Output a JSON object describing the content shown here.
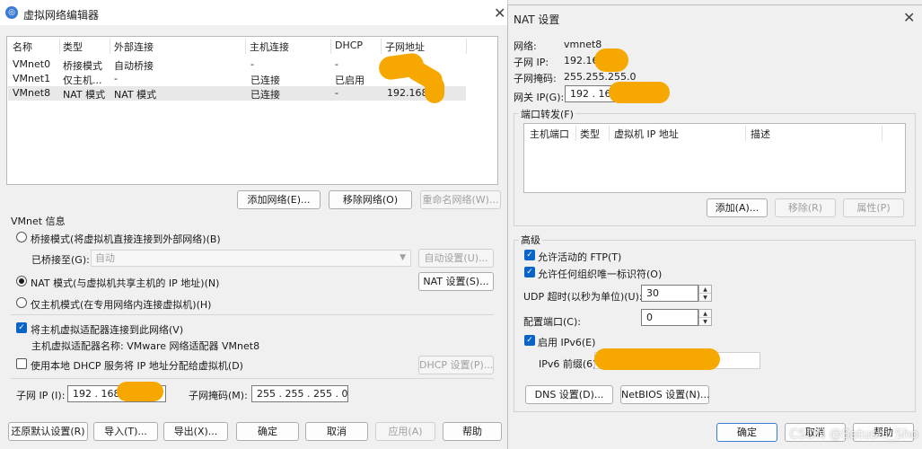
{
  "left": {
    "title": "虚拟网络编辑器",
    "table": {
      "headers": [
        "名称",
        "类型",
        "外部连接",
        "主机连接",
        "DHCP",
        "子网地址"
      ],
      "rows": [
        [
          "VMnet0",
          "桥接模式",
          "自动桥接",
          "-",
          "-",
          ""
        ],
        [
          "VMnet1",
          "仅主机...",
          "-",
          "已连接",
          "已启用",
          ""
        ],
        [
          "VMnet8",
          "NAT 模式",
          "NAT 模式",
          "已连接",
          "-",
          "192.168."
        ]
      ]
    },
    "buttons": {
      "add_network": "添加网络(E)...",
      "remove_network": "移除网络(O)",
      "rename_network": "重命名网络(W)..."
    },
    "vmnet_info": {
      "title": "VMnet 信息",
      "bridge_mode": "桥接模式(将虚拟机直接连接到外部网络)(B)",
      "bridged_to_label": "已桥接至(G):",
      "bridged_to_value": "自动",
      "auto_settings": "自动设置(U)...",
      "nat_mode": "NAT 模式(与虚拟机共享主机的 IP 地址)(N)",
      "nat_settings": "NAT 设置(S)...",
      "host_only": "仅主机模式(在专用网络内连接虚拟机)(H)",
      "connect_adapter": "将主机虚拟适配器连接到此网络(V)",
      "adapter_name": "主机虚拟适配器名称: VMware 网络适配器 VMnet8",
      "use_dhcp": "使用本地 DHCP 服务将 IP 地址分配给虚拟机(D)",
      "dhcp_settings": "DHCP 设置(P)...",
      "subnet_ip_label": "子网 IP (I):",
      "subnet_ip_value": "192 . 168",
      "subnet_mask_label": "子网掩码(M):",
      "subnet_mask_value": "255 . 255 . 255 . 0"
    },
    "footer": {
      "restore_defaults": "还原默认设置(R)",
      "import": "导入(T)...",
      "export": "导出(X)...",
      "ok": "确定",
      "cancel": "取消",
      "apply": "应用(A)",
      "help": "帮助"
    }
  },
  "right": {
    "title": "NAT 设置",
    "network_label": "网络:",
    "network_value": "vmnet8",
    "subnet_ip_label": "子网 IP:",
    "subnet_ip_value": "192.16",
    "subnet_mask_label": "子网掩码:",
    "subnet_mask_value": "255.255.255.0",
    "gateway_label": "网关 IP(G):",
    "gateway_value": "192 . 168",
    "port_forwarding": {
      "title": "端口转发(F)",
      "headers": [
        "主机端口",
        "类型",
        "虚拟机 IP 地址",
        "描述"
      ],
      "add": "添加(A)...",
      "remove": "移除(R)",
      "properties": "属性(P)"
    },
    "advanced": {
      "title": "高级",
      "allow_ftp": "允许活动的 FTP(T)",
      "allow_org_id": "允许任何组织唯一标识符(O)",
      "udp_timeout_label": "UDP 超时(以秒为单位)(U):",
      "udp_timeout_value": "30",
      "config_port_label": "配置端口(C):",
      "config_port_value": "0",
      "enable_ipv6": "启用 IPv6(E)",
      "ipv6_prefix_label": "IPv6 前缀(6):"
    },
    "buttons": {
      "dns": "DNS 设置(D)...",
      "netbios": "NetBIOS 设置(N)...",
      "ok": "确定",
      "cancel": "取消",
      "help": "帮助"
    }
  },
  "watermark": "CSDN @Satushi_Sho",
  "colors": {
    "redaction": "#f7a800",
    "accent": "#0a64c8"
  }
}
